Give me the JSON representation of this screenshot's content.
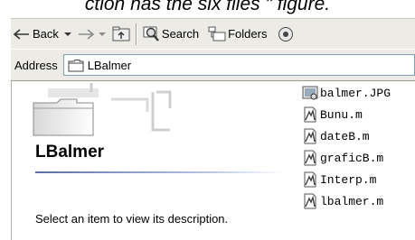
{
  "caption": "ction has the six files \" figure.",
  "toolbar": {
    "back_label": "Back",
    "search_label": "Search",
    "folders_label": "Folders"
  },
  "address": {
    "label": "Address",
    "value": "LBalmer"
  },
  "folder": {
    "title": "LBalmer",
    "description": "Select an item to view its description."
  },
  "files": [
    {
      "name": "balmer.JPG",
      "icon": "image-file-icon"
    },
    {
      "name": "Bunu.m",
      "icon": "matlab-file-icon"
    },
    {
      "name": "dateB.m",
      "icon": "matlab-file-icon"
    },
    {
      "name": "graficB.m",
      "icon": "matlab-file-icon"
    },
    {
      "name": "Interp.m",
      "icon": "matlab-file-icon"
    },
    {
      "name": "lbalmer.m",
      "icon": "matlab-file-icon"
    }
  ],
  "colors": {
    "toolbar_bg": "#ecebe6",
    "address_border": "#7f9db9",
    "title_rule": "#5a6ea5"
  }
}
